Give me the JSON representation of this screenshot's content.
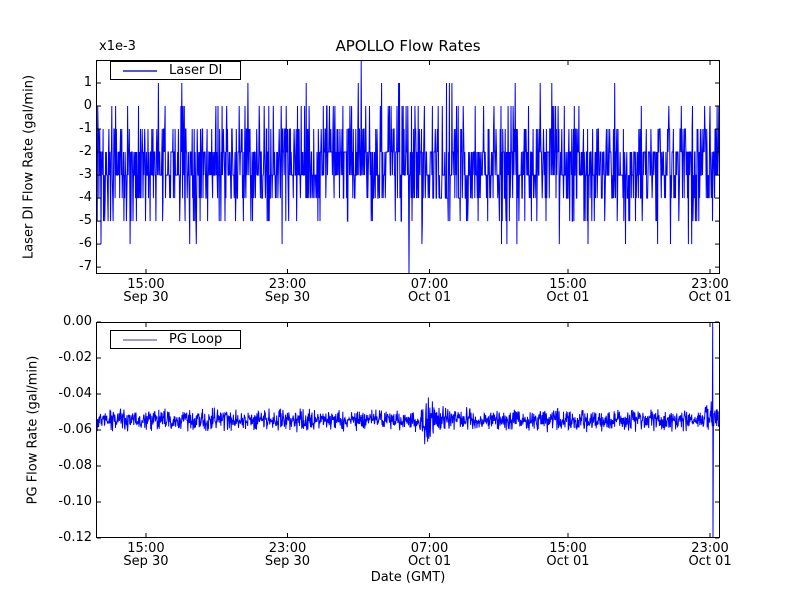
{
  "chart_data": [
    {
      "id": "laser",
      "type": "line",
      "title": "APOLLO Flow Rates",
      "ylabel": "Laser DI Flow Rate (gal/min)",
      "y_offset_text": "x1e-3",
      "legend": {
        "label": "Laser DI",
        "line_color": "#5656dd",
        "position": "upper-left"
      },
      "line_color": "#0000ff",
      "ylim": [
        -0.0073,
        0.002
      ],
      "yticks": [
        0.001,
        0,
        -0.001,
        -0.002,
        -0.003,
        -0.004,
        -0.005,
        -0.006,
        -0.007
      ],
      "ytick_labels": [
        "1",
        "0",
        "-1",
        "-2",
        "-3",
        "-4",
        "-5",
        "-6",
        "-7"
      ],
      "xtick_fracs": [
        0.0801,
        0.3069,
        0.5345,
        0.7564,
        0.984
      ],
      "xtick_labels": [
        [
          "15:00",
          "Sep 30"
        ],
        [
          "23:00",
          "Sep 30"
        ],
        [
          "07:00",
          "Oct 01"
        ],
        [
          "15:00",
          "Oct 01"
        ],
        [
          "23:00",
          "Oct 01"
        ]
      ],
      "grid": false,
      "signal": {
        "kind": "quantized",
        "n": 1500,
        "seed": 1234,
        "unit": 0.001,
        "levels": [
          1,
          0,
          -1,
          -2,
          -3,
          -4,
          -5,
          -6
        ],
        "weights": [
          0.008,
          0.055,
          0.115,
          0.3,
          0.3,
          0.155,
          0.054,
          0.013
        ],
        "extremes": [
          {
            "x_frac": 0.425,
            "value": 0.002
          },
          {
            "x_frac": 0.502,
            "value": -0.0073
          }
        ],
        "description": "Quantized noisy flow signal, dense band -0.002..-0.004 gal/min, 0.001 resolution, max 0.002 at ~Oct 01 03:00, min -0.0073 at ~Oct 01 05:30"
      }
    },
    {
      "id": "pg",
      "type": "line",
      "ylabel": "PG Flow Rate (gal/min)",
      "xlabel": "Date (GMT)",
      "legend": {
        "label": "PG Loop",
        "line_color": "#9a9ae8",
        "position": "upper-left"
      },
      "line_color": "#0000ff",
      "ylim": [
        -0.12,
        0.0
      ],
      "yticks": [
        0,
        -0.02,
        -0.04,
        -0.06,
        -0.08,
        -0.1,
        -0.12
      ],
      "ytick_labels": [
        "0.00",
        "-0.02",
        "-0.04",
        "-0.06",
        "-0.08",
        "-0.10",
        "-0.12"
      ],
      "xtick_fracs": [
        0.0801,
        0.3069,
        0.5345,
        0.7564,
        0.984
      ],
      "xtick_labels": [
        [
          "15:00",
          "Sep 30"
        ],
        [
          "23:00",
          "Sep 30"
        ],
        [
          "07:00",
          "Oct 01"
        ],
        [
          "15:00",
          "Oct 01"
        ],
        [
          "23:00",
          "Oct 01"
        ]
      ],
      "grid": false,
      "signal": {
        "kind": "noisy-baseline",
        "n": 1700,
        "seed": 99,
        "baseline": -0.0545,
        "noise": 0.007,
        "bursts": [
          {
            "x_frac": 0.533,
            "width_frac": 0.012,
            "amp": 0.011
          },
          {
            "x_frac": 0.548,
            "width_frac": 0.05,
            "amp": 0.002
          },
          {
            "x_frac": 0.985,
            "width_frac": 0.01,
            "amp": 0.008
          }
        ],
        "full_spike": {
          "x_frac": 0.988,
          "top": 0.0,
          "bottom": -0.12
        },
        "description": "Steady flow ~-0.0545 gal/min; noise burst (-0.042..-0.071) around Oct 01 07:00; full-range spike (0.00 to -0.12) just after Oct 01 23:00"
      }
    }
  ]
}
